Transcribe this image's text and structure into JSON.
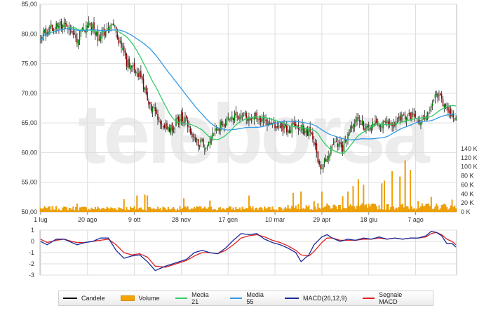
{
  "chart_data": {
    "type": "candlestick",
    "watermark": "teleborsa",
    "colors": {
      "candle_up": "#008000",
      "candle_down": "#8b0000",
      "volume": "#f5a400",
      "media21": "#33cc66",
      "media55": "#3399e6",
      "macd": "#1a2a99",
      "signal": "#dd2222",
      "panel_bg": "#ffffff",
      "grid": "#dddddd"
    },
    "x_axis": {
      "ticks": [
        "1 lug",
        "20 ago",
        "9 ott",
        "28 nov",
        "17 gen",
        "10 mar",
        "29 apr",
        "18 giu",
        "7 ago"
      ],
      "tick_index": [
        0,
        36,
        72,
        108,
        144,
        180,
        216,
        252,
        288
      ]
    },
    "price_axis": {
      "ylim": [
        50,
        85
      ],
      "ticks": [
        "50,00",
        "55,00",
        "60,00",
        "65,00",
        "70,00",
        "75,00",
        "80,00",
        "85,00"
      ],
      "tick_values": [
        50,
        55,
        60,
        65,
        70,
        75,
        80,
        85
      ]
    },
    "volume_axis": {
      "ylim": [
        0,
        140000
      ],
      "ticks": [
        "0 K",
        "20 K",
        "40 K",
        "60 K",
        "80 K",
        "100 K",
        "120 K",
        "140 K"
      ],
      "tick_values": [
        0,
        20000,
        40000,
        60000,
        80000,
        100000,
        120000,
        140000
      ]
    },
    "macd_axis": {
      "ylim": [
        -3,
        1
      ],
      "ticks": [
        "1",
        "0",
        "-1",
        "-2",
        "-3"
      ],
      "tick_values": [
        1,
        0,
        -1,
        -2,
        -3
      ]
    },
    "close_path": {
      "index": [
        0,
        8,
        12,
        20,
        28,
        36,
        40,
        44,
        50,
        56,
        60,
        66,
        72,
        78,
        84,
        92,
        100,
        108,
        112,
        116,
        122,
        128,
        134,
        140,
        146,
        152,
        158,
        164,
        170,
        176,
        182,
        186,
        190,
        194,
        200,
        206,
        210,
        214,
        217,
        220,
        226,
        232,
        238,
        244,
        250,
        256,
        262,
        268,
        274,
        280,
        286,
        292,
        296,
        300,
        304,
        307,
        310,
        313,
        316,
        319
      ],
      "close": [
        79.5,
        81.0,
        81.5,
        81.0,
        79.0,
        81.5,
        81.0,
        79.5,
        80.5,
        82.0,
        79.0,
        75.0,
        74.5,
        72.0,
        68.0,
        65.5,
        64.0,
        66.0,
        65.0,
        62.5,
        61.5,
        61.0,
        63.5,
        65.0,
        65.5,
        66.5,
        66.0,
        66.5,
        65.5,
        64.5,
        65.0,
        64.0,
        63.5,
        64.5,
        64.0,
        63.5,
        62.0,
        58.0,
        57.5,
        59.5,
        62.0,
        61.0,
        64.5,
        65.5,
        64.0,
        65.0,
        64.5,
        65.0,
        65.5,
        66.0,
        66.5,
        65.5,
        66.5,
        68.0,
        70.0,
        69.0,
        68.0,
        66.5,
        67.0,
        66.0
      ],
      "n": 320
    },
    "volume_path": {
      "baseline": 6000,
      "spikes": [
        [
          28,
          18000
        ],
        [
          60,
          10000
        ],
        [
          64,
          28000
        ],
        [
          74,
          36000
        ],
        [
          80,
          38000
        ],
        [
          82,
          36000
        ],
        [
          110,
          30000
        ],
        [
          122,
          12000
        ],
        [
          130,
          25000
        ],
        [
          160,
          36000
        ],
        [
          190,
          15000
        ],
        [
          194,
          28000
        ],
        [
          200,
          30000
        ],
        [
          210,
          16000
        ],
        [
          216,
          30000
        ],
        [
          232,
          23000
        ],
        [
          236,
          30000
        ],
        [
          240,
          38000
        ],
        [
          244,
          48000
        ],
        [
          248,
          40000
        ],
        [
          262,
          42000
        ],
        [
          264,
          46000
        ],
        [
          270,
          60000
        ],
        [
          276,
          52000
        ],
        [
          280,
          76000
        ],
        [
          284,
          62000
        ],
        [
          290,
          16000
        ],
        [
          300,
          22000
        ],
        [
          310,
          12000
        ],
        [
          316,
          18000
        ]
      ]
    },
    "macd_path": {
      "index": [
        0,
        5,
        12,
        18,
        24,
        28,
        34,
        40,
        46,
        52,
        58,
        64,
        70,
        76,
        82,
        88,
        96,
        104,
        112,
        118,
        124,
        130,
        136,
        142,
        148,
        154,
        160,
        166,
        172,
        178,
        184,
        190,
        196,
        200,
        206,
        210,
        216,
        220,
        224,
        230,
        236,
        242,
        248,
        254,
        260,
        266,
        272,
        278,
        284,
        290,
        296,
        300,
        304,
        308,
        312,
        316,
        319
      ],
      "macd": [
        0.0,
        -0.3,
        0.2,
        0.2,
        -0.1,
        -0.3,
        -0.1,
        0.0,
        0.3,
        0.3,
        -0.8,
        -1.5,
        -1.3,
        -1.2,
        -1.8,
        -2.6,
        -2.2,
        -1.9,
        -1.6,
        -1.0,
        -0.8,
        -1.0,
        -1.1,
        -0.6,
        0.1,
        0.7,
        0.6,
        0.7,
        0.2,
        -0.1,
        -0.3,
        -0.6,
        -1.0,
        -1.8,
        -1.2,
        -0.3,
        0.4,
        0.6,
        0.3,
        0.0,
        0.2,
        0.1,
        0.3,
        0.2,
        0.4,
        0.2,
        0.3,
        0.2,
        0.3,
        0.3,
        0.5,
        0.9,
        0.8,
        0.5,
        -0.2,
        -0.2,
        -0.5
      ],
      "signal": [
        0.2,
        -0.1,
        0.1,
        0.2,
        0.0,
        -0.1,
        -0.1,
        0.0,
        0.1,
        0.2,
        -0.3,
        -1.0,
        -1.2,
        -1.1,
        -1.4,
        -2.2,
        -2.3,
        -2.0,
        -1.7,
        -1.3,
        -1.0,
        -1.0,
        -1.1,
        -0.8,
        -0.3,
        0.3,
        0.5,
        0.6,
        0.4,
        0.1,
        -0.1,
        -0.4,
        -0.8,
        -1.2,
        -1.3,
        -0.9,
        -0.1,
        0.3,
        0.3,
        0.1,
        0.1,
        0.1,
        0.2,
        0.2,
        0.3,
        0.2,
        0.3,
        0.2,
        0.3,
        0.3,
        0.4,
        0.7,
        0.8,
        0.6,
        0.2,
        0.0,
        -0.3
      ]
    }
  },
  "legend": [
    {
      "id": "candele",
      "label": "Candele",
      "color": "#000000",
      "kind": "line"
    },
    {
      "id": "volume",
      "label": "Volume",
      "color": "#f5a400",
      "kind": "box"
    },
    {
      "id": "media21",
      "label": "Media 21",
      "color": "#33cc66",
      "kind": "line"
    },
    {
      "id": "media55",
      "label": "Media 55",
      "color": "#3399e6",
      "kind": "line"
    },
    {
      "id": "macd",
      "label": "MACD(26,12,9)",
      "color": "#1a2a99",
      "kind": "line"
    },
    {
      "id": "signal",
      "label": "Segnale MACD",
      "color": "#dd2222",
      "kind": "line"
    }
  ]
}
